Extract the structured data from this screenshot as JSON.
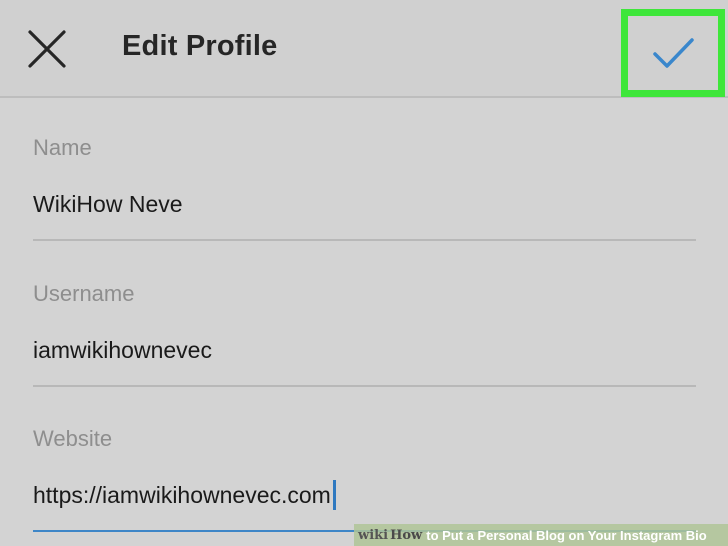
{
  "header": {
    "title": "Edit Profile",
    "close_icon": "close-icon",
    "confirm_icon": "checkmark-icon",
    "confirm_color": "#3a87cc",
    "highlight_color": "#3ee63a"
  },
  "form": {
    "name": {
      "label": "Name",
      "value": "WikiHow Neve"
    },
    "username": {
      "label": "Username",
      "value": "iamwikihownevec"
    },
    "website": {
      "label": "Website",
      "value": "https://iamwikihownevec.com"
    }
  },
  "watermark": {
    "brand_wiki": "wiki",
    "brand_how": "How",
    "text": "to Put a Personal Blog on Your Instagram Bio"
  }
}
